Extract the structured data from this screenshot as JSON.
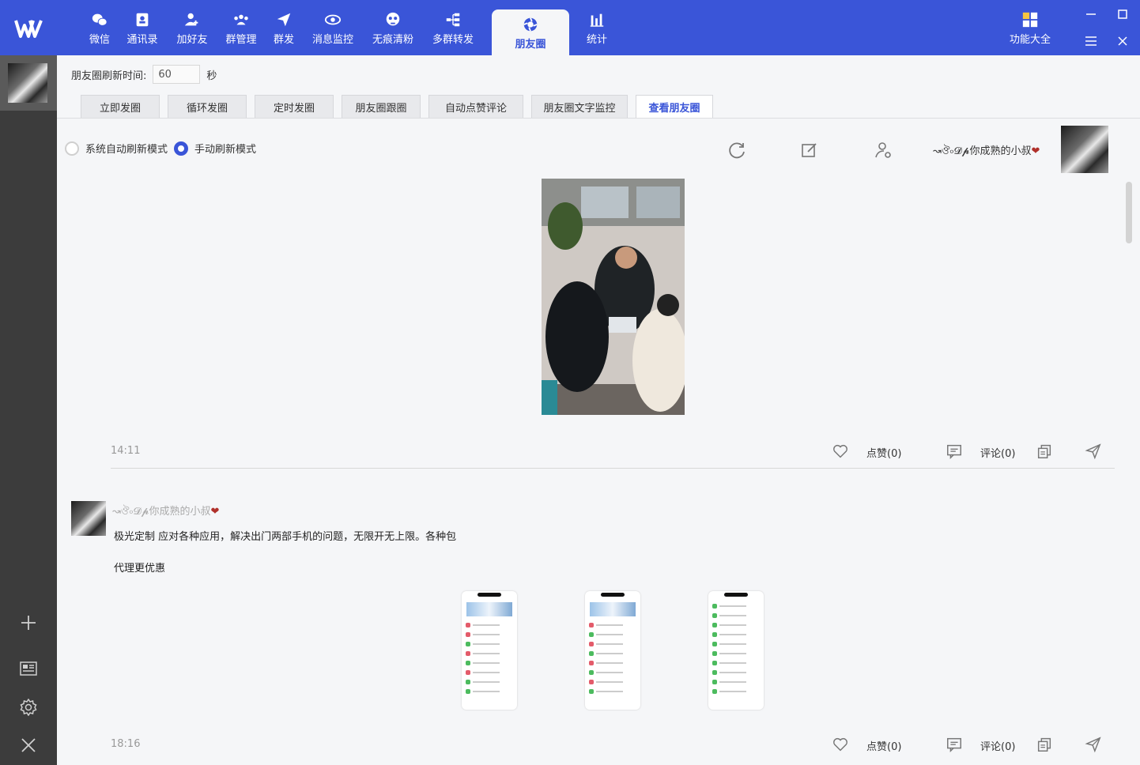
{
  "nav": {
    "items": [
      {
        "label": "微信",
        "icon": "wechat-icon"
      },
      {
        "label": "通讯录",
        "icon": "contacts-icon"
      },
      {
        "label": "加好友",
        "icon": "add-friend-icon"
      },
      {
        "label": "群管理",
        "icon": "group-icon"
      },
      {
        "label": "群发",
        "icon": "send-icon"
      },
      {
        "label": "消息监控",
        "icon": "eye-icon"
      },
      {
        "label": "无痕清粉",
        "icon": "skull-icon"
      },
      {
        "label": "多群转发",
        "icon": "forward-icon"
      },
      {
        "label": "朋友圈",
        "icon": "moments-icon",
        "active": true
      },
      {
        "label": "统计",
        "icon": "stats-icon"
      }
    ],
    "features_label": "功能大全"
  },
  "settings": {
    "refresh_label": "朋友圈刷新时间:",
    "refresh_value": "60",
    "refresh_unit": "秒"
  },
  "tabs": [
    {
      "label": "立即发圈"
    },
    {
      "label": "循环发圈"
    },
    {
      "label": "定时发圈"
    },
    {
      "label": "朋友圈跟圈"
    },
    {
      "label": "自动点赞评论"
    },
    {
      "label": "朋友圈文字监控"
    },
    {
      "label": "查看朋友圈",
      "active": true
    }
  ],
  "modes": {
    "auto_label": "系统自动刷新模式",
    "manual_label": "手动刷新模式",
    "selected": "manual"
  },
  "account": {
    "nickname": "↝ঔ৹𝓓𝓹你成熟的小叔",
    "heart": "❤"
  },
  "posts": [
    {
      "time": "14:11",
      "like_label": "点赞(0)",
      "comment_label": "评论(0)"
    },
    {
      "nickname": "↝ঔ৹𝓓𝓹你成熟的小叔",
      "heart": "❤",
      "text_line1": "极光定制 应对各种应用，解决出门两部手机的问题，无限开无上限。各种包",
      "text_line2": "代理更优惠",
      "time": "18:16",
      "like_label": "点赞(0)",
      "comment_label": "评论(0)"
    }
  ],
  "colors": {
    "primary": "#3a55d8",
    "sidebar": "#3c3c3c"
  }
}
